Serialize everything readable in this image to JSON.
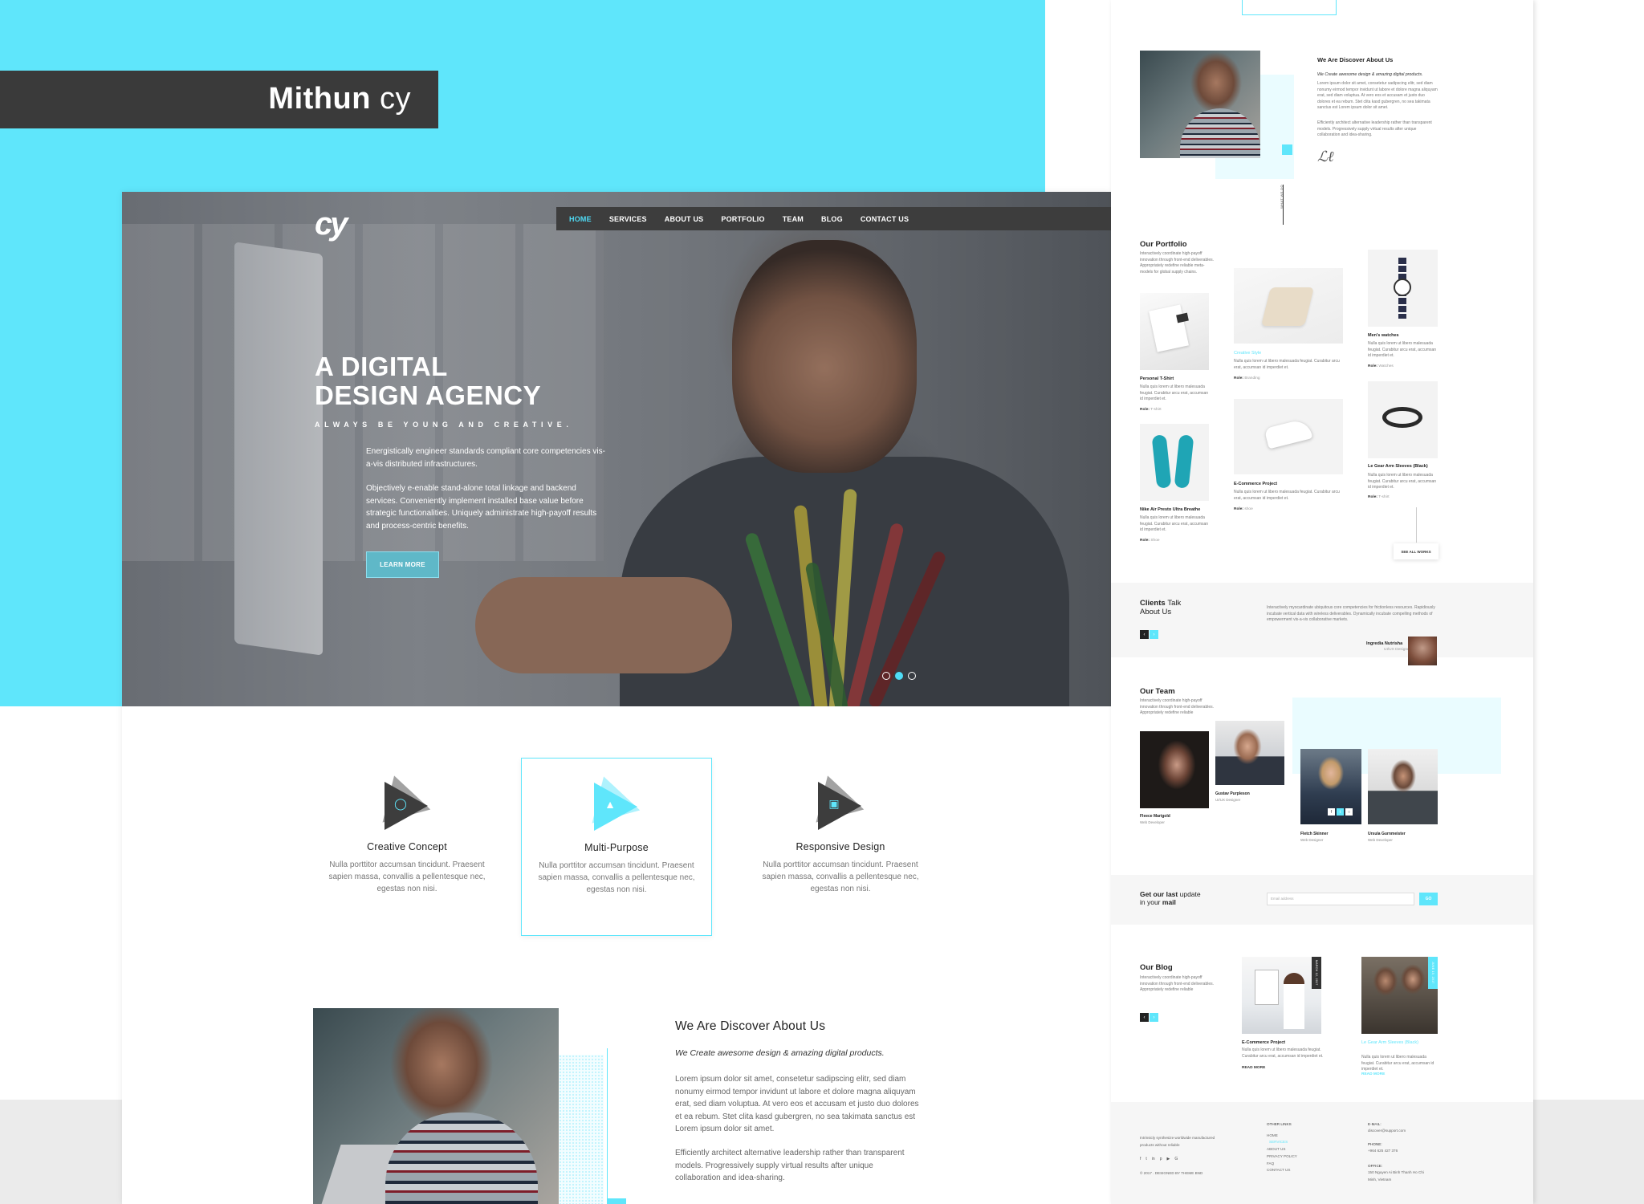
{
  "brand": {
    "name_bold": "Mithun",
    "name_light": "cy"
  },
  "hero": {
    "logo": "cy",
    "nav": [
      "HOME",
      "SERVICES",
      "ABOUT US",
      "PORTFOLIO",
      "TEAM",
      "BLOG",
      "CONTACT US"
    ],
    "title": "A DIGITAL\nDESIGN AGENCY",
    "subtitle": "ALWAYS BE YOUNG AND CREATIVE.",
    "p1": "Energistically engineer standards compliant core competencies vis-a-vis distributed infrastructures.",
    "p2": "Objectively e-enable stand-alone total linkage and backend services. Conveniently implement installed base value before strategic functionalities. Uniquely administrate high-payoff results and process-centric benefits.",
    "button": "LEARN MORE",
    "slides": 3,
    "active_slide": 2
  },
  "features": [
    {
      "icon": "lightbulb",
      "title": "Creative Concept",
      "text": "Nulla porttitor accumsan tincidunt. Praesent sapien massa, convallis a pellentesque nec, egestas non nisi."
    },
    {
      "icon": "flask",
      "title": "Multi-Purpose",
      "text": "Nulla porttitor accumsan tincidunt. Praesent sapien massa, convallis a pellentesque nec, egestas non nisi."
    },
    {
      "icon": "laptop",
      "title": "Responsive Design",
      "text": "Nulla porttitor accumsan tincidunt. Praesent sapien massa, convallis a pellentesque nec, egestas non nisi."
    }
  ],
  "about": {
    "heading": "We Are Discover About Us",
    "tagline": "We Create awesome design & amazing digital products.",
    "p1": "Lorem ipsum dolor sit amet, consetetur sadipscing elitr, sed diam nonumy eirmod tempor invidunt ut labore et dolore magna aliquyam erat, sed diam voluptua. At vero eos et accusam et justo duo dolores et ea rebum. Stet clita kasd gubergren, no sea takimata sanctus est Lorem ipsum dolor sit amet.",
    "p2": "Efficiently architect alternative leadership rather than transparent models. Progressively supply virtual results after unique collaboration and idea-sharing."
  },
  "preview": {
    "about_vertical": "WHAT WE DO",
    "portfolio": {
      "heading": "Our Portfolio",
      "intro": "Interactively coordinate high-payoff innovation through front-end deliverables. Appropriately redefine reliable meta-models for global supply chains.",
      "items": [
        {
          "title": "Personal T-Shirt",
          "role": "T-shirt",
          "text": "Nulla quis lorem ut libero malesuada feugiat. Curabitur arcu erat, accumsan id imperdiet et."
        },
        {
          "title": "Creative Style",
          "role": "Branding",
          "text": "Nulla quis lorem ut libero malesuada feugiat. Curabitur arcu erat, accumsan id imperdiet et."
        },
        {
          "title": "Men's watches",
          "role": "Watches",
          "text": "Nulla quis lorem ut libero malesuada feugiat. Curabitur arcu erat, accumsan id imperdiet et."
        },
        {
          "title": "Nike Air Presto Ultra Breathe",
          "role": "Shoe",
          "text": "Nulla quis lorem ut libero malesuada feugiat. Curabitur arcu erat, accumsan id imperdiet et."
        },
        {
          "title": "E-Commerce Project",
          "role": "shoe",
          "text": "Nulla quis lorem ut libero malesuada feugiat. Curabitur arcu erat, accumsan id imperdiet et."
        },
        {
          "title": "Le Gear Arm Sleeves (Black)",
          "role": "T-shirt",
          "text": "Nulla quis lorem ut libero malesuada feugiat. Curabitur arcu erat, accumsan id imperdiet et."
        }
      ],
      "role_label": "Role:",
      "see_all": "SEE ALL WORKS"
    },
    "clients": {
      "heading_bold": "Clients",
      "heading_light": "Talk",
      "heading_line2": "About Us",
      "quote": "Interactively myocardinate ubiquitous core competencies for frictionless resources. Rapidiously incubate vertical data with wireless deliverables. Dynamically incubate compelling methods of empowerment vis-a-vis collaborative markets.",
      "name": "Ingredia Nutrisha",
      "role": "UI/UX Designer"
    },
    "team": {
      "heading": "Our Team",
      "intro": "Interactively coordinate high-payoff innovation through front-end deliverables. Appropriately redefine reliable",
      "members": [
        {
          "name": "Fleece Marigold",
          "role": "Web Developer"
        },
        {
          "name": "Gustav Purpleson",
          "role": "UI/UX Designer"
        },
        {
          "name": "Fletch Skinner",
          "role": "Web Designer"
        },
        {
          "name": "Ursula Gurnmeister",
          "role": "Web Developer"
        }
      ]
    },
    "newsletter": {
      "pre": "Get our last",
      "mid": "update",
      "line2_pre": "in your",
      "line2_bold": "mail",
      "placeholder": "Email address",
      "button": "GO"
    },
    "blog": {
      "heading": "Our Blog",
      "intro": "Interactively coordinate high-payoff innovation through front-end deliverables. Appropriately redefine reliable",
      "posts": [
        {
          "title": "E-Commerce Project",
          "tag": "MARCH 12, 2017",
          "text": "Nulla quis lorem ut libero malesuada feugiat. Curabitur arcu erat, accumsan id imperdiet et.",
          "more": "READ MORE"
        },
        {
          "title": "Le Gear Arm Sleeves (Black)",
          "tag": "JUNE 15, 2017",
          "text": "Nulla quis lorem ut libero malesuada feugiat. Curabitur arcu erat, accumsan id imperdiet et.",
          "more": "READ MORE"
        }
      ]
    },
    "footer": {
      "about": "Intrinsicly synthesize worldwide manufactured products without reliable",
      "copyright": "© 2017 . DESIGNED BY",
      "credit": "THEME BND",
      "links_heading": "OTHER LINKS",
      "links": [
        "HOME",
        "SERVICES",
        "ABOUT US",
        "PRIVACY POLICY",
        "FAQ",
        "CONTACT US"
      ],
      "email_label": "E-MAIL:",
      "email": "discover@support.com",
      "phone_label": "PHONE:",
      "phone": "+964 625 427 376",
      "office_label": "OFFICE:",
      "office": "150 Nguyen Ai Binh Thanh Ho Chi Minh, Vietnam"
    }
  },
  "colors": {
    "accent": "#5fe6fb",
    "dark": "#3a3a3a"
  }
}
